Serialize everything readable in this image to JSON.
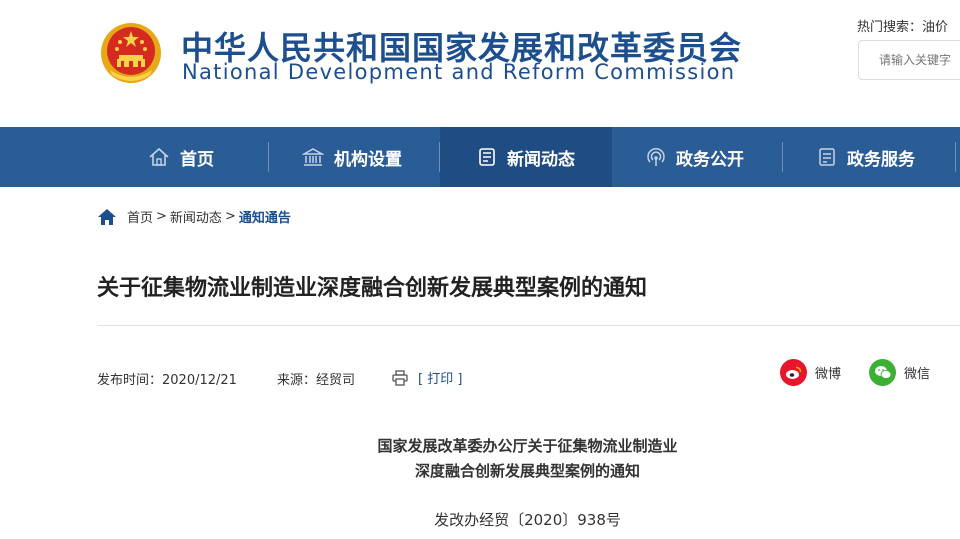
{
  "header": {
    "title_cn": "中华人民共和国国家发展和改革委员会",
    "title_en": "National Development and Reform Commission",
    "hot_search": "热门搜索：油价",
    "search_placeholder": "请输入关键字"
  },
  "nav": {
    "items": [
      {
        "label": "首页",
        "icon": "home-icon"
      },
      {
        "label": "机构设置",
        "icon": "institution-icon"
      },
      {
        "label": "新闻动态",
        "icon": "news-icon",
        "active": true
      },
      {
        "label": "政务公开",
        "icon": "broadcast-icon"
      },
      {
        "label": "政务服务",
        "icon": "service-icon"
      }
    ]
  },
  "breadcrumb": {
    "home": "首页",
    "sep": ">",
    "section": "新闻动态",
    "current": "通知通告"
  },
  "article": {
    "title": "关于征集物流业制造业深度融合创新发展典型案例的通知",
    "publish_time": "发布时间：2020/12/21",
    "source": "来源：经贸司",
    "print_label": "[ 打印 ]",
    "doc_title_line1": "国家发展改革委办公厅关于征集物流业制造业",
    "doc_title_line2": "深度融合创新发展典型案例的通知",
    "doc_number": "发改办经贸〔2020〕938号"
  },
  "share": {
    "weibo": "微博",
    "wechat": "微信"
  },
  "colors": {
    "brand": "#1d4f8f",
    "nav_bg": "#2a5c96",
    "nav_active": "#1f4d83",
    "weibo": "#e6162d",
    "wechat": "#3cb034"
  }
}
